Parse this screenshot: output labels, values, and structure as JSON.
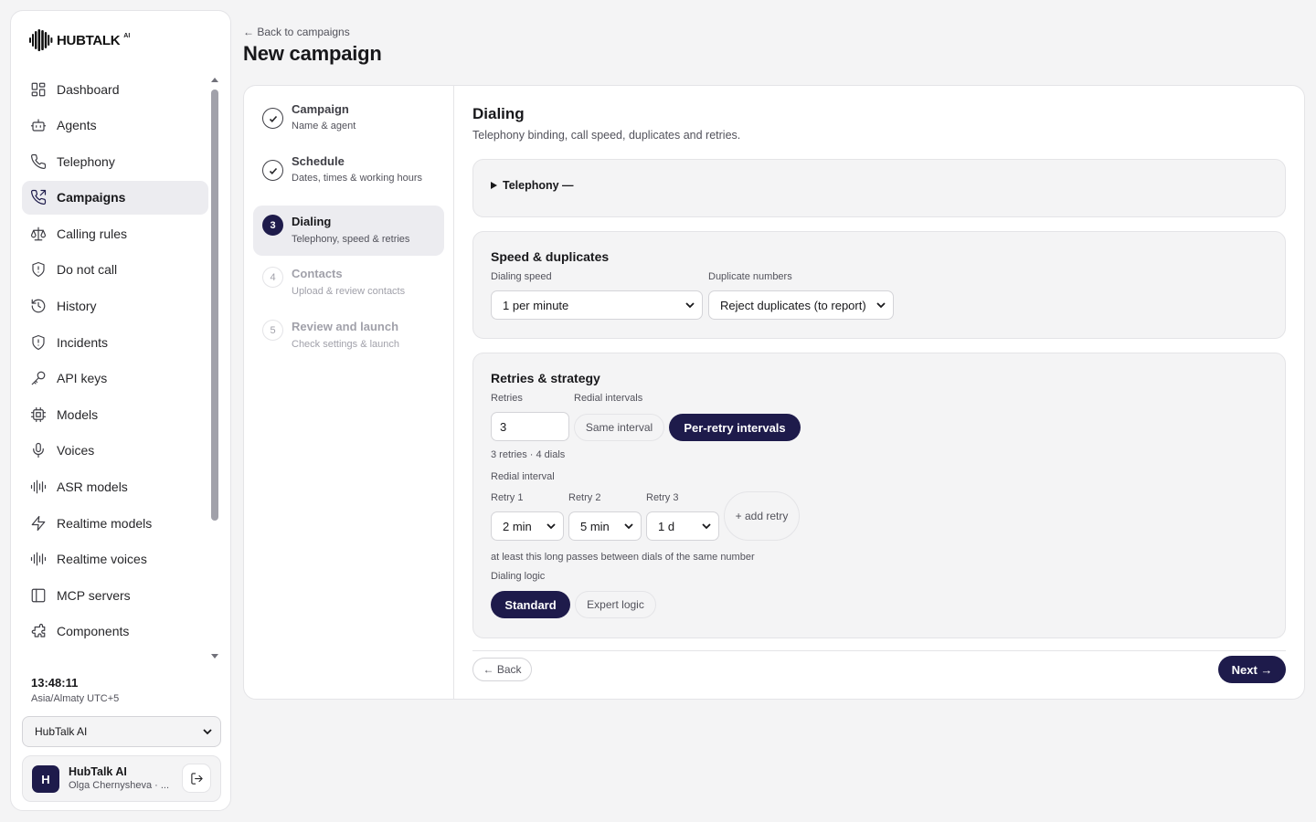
{
  "brand": {
    "name": "HUBTALK",
    "suffix": "AI"
  },
  "sidebar": {
    "items": [
      {
        "label": "Dashboard",
        "icon": "dashboard-icon"
      },
      {
        "label": "Agents",
        "icon": "robot-icon"
      },
      {
        "label": "Telephony",
        "icon": "phone-icon"
      },
      {
        "label": "Campaigns",
        "icon": "phone-outgoing-icon",
        "active": true
      },
      {
        "label": "Calling rules",
        "icon": "scale-icon"
      },
      {
        "label": "Do not call",
        "icon": "shield-icon"
      },
      {
        "label": "History",
        "icon": "history-icon"
      },
      {
        "label": "Incidents",
        "icon": "shield-alert-icon"
      },
      {
        "label": "API keys",
        "icon": "key-icon"
      },
      {
        "label": "Models",
        "icon": "chip-icon"
      },
      {
        "label": "Voices",
        "icon": "microphone-icon"
      },
      {
        "label": "ASR models",
        "icon": "waveform-icon"
      },
      {
        "label": "Realtime models",
        "icon": "lightning-icon"
      },
      {
        "label": "Realtime voices",
        "icon": "waveform-icon"
      },
      {
        "label": "MCP servers",
        "icon": "panel-icon"
      },
      {
        "label": "Components",
        "icon": "puzzle-icon"
      }
    ],
    "clock": "13:48:11",
    "timezone": "Asia/Almaty UTC+5",
    "org_select": "HubTalk AI",
    "user": {
      "initial": "H",
      "name": "HubTalk AI",
      "subtitle": "Olga Chernysheva · ..."
    }
  },
  "header": {
    "back_link": "← Back to campaigns",
    "title": "New campaign"
  },
  "steps": [
    {
      "title": "Campaign",
      "subtitle": "Name & agent",
      "state": "done",
      "number": "1"
    },
    {
      "title": "Schedule",
      "subtitle": "Dates, times & working hours",
      "state": "done",
      "number": "2"
    },
    {
      "title": "Dialing",
      "subtitle": "Telephony, speed & retries",
      "state": "active",
      "number": "3"
    },
    {
      "title": "Contacts",
      "subtitle": "Upload & review contacts",
      "state": "future",
      "number": "4"
    },
    {
      "title": "Review and launch",
      "subtitle": "Check settings & launch",
      "state": "future",
      "number": "5"
    }
  ],
  "dialing": {
    "title": "Dialing",
    "description": "Telephony binding, call speed, duplicates and retries.",
    "telephony_summary": "Telephony —",
    "speed_panel": {
      "title": "Speed & duplicates",
      "speed_label": "Dialing speed",
      "speed_value": "1 per minute",
      "dup_label": "Duplicate numbers",
      "dup_value": "Reject duplicates (to report)"
    },
    "retries_panel": {
      "title": "Retries & strategy",
      "retries_label": "Retries",
      "retries_value": "3",
      "redial_intervals_label": "Redial intervals",
      "same_interval": "Same interval",
      "per_retry": "Per-retry intervals",
      "summary": "3 retries · 4 dials",
      "redial_interval_label": "Redial interval",
      "retries": [
        {
          "label": "Retry 1",
          "value": "2 min"
        },
        {
          "label": "Retry 2",
          "value": "5 min"
        },
        {
          "label": "Retry 3",
          "value": "1 d"
        }
      ],
      "add_retry": "+ add retry",
      "note": "at least this long passes between dials of the same number",
      "logic_label": "Dialing logic",
      "logic_standard": "Standard",
      "logic_expert": "Expert logic"
    },
    "back_button": "← Back",
    "next_button": "Next →"
  }
}
